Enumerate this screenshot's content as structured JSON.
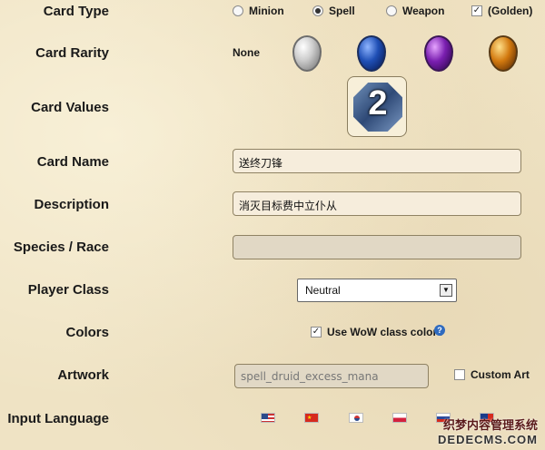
{
  "labels": {
    "card_type": "Card Type",
    "card_rarity": "Card Rarity",
    "card_values": "Card Values",
    "card_name": "Card Name",
    "description": "Description",
    "species": "Species / Race",
    "player_class": "Player Class",
    "colors": "Colors",
    "artwork": "Artwork",
    "input_language": "Input Language"
  },
  "card_type": {
    "options": [
      "Minion",
      "Spell",
      "Weapon"
    ],
    "selected": "Spell",
    "golden_label": "(Golden)",
    "golden_checked": true
  },
  "rarity": {
    "none_label": "None",
    "gems": [
      "silver-gem-icon",
      "blue-gem-icon",
      "purple-gem-icon",
      "orange-gem-icon"
    ]
  },
  "card_values": {
    "cost": "2"
  },
  "card_name": {
    "value": "送终刀锋"
  },
  "description": {
    "value": "消灭目标费中立仆从"
  },
  "species": {
    "value": ""
  },
  "player_class": {
    "selected": "Neutral"
  },
  "colors": {
    "use_wow_label": "Use WoW class colors",
    "checked": true
  },
  "artwork": {
    "placeholder": "spell_druid_excess_mana",
    "custom_art_label": "Custom Art",
    "custom_art_checked": false
  },
  "language_flags": [
    "us-flag-icon",
    "china-flag-icon",
    "korea-flag-icon",
    "poland-flag-icon",
    "russia-flag-icon",
    "taiwan-flag-icon"
  ],
  "watermark": {
    "line1": "织梦内容管理系统",
    "line2": "DEDECMS.COM"
  }
}
